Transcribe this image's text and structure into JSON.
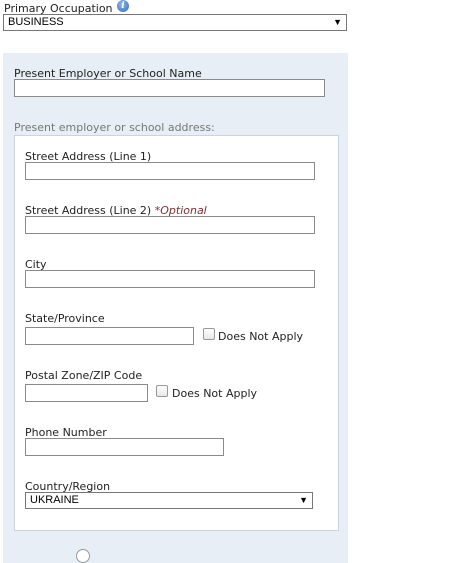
{
  "primary_occupation": {
    "label": "Primary Occupation",
    "value": "BUSINESS"
  },
  "employer": {
    "name_label": "Present Employer or School Name",
    "name_value": "",
    "address_heading": "Present employer or school address:",
    "street1_label": "Street Address (Line 1)",
    "street2_label": "Street Address (Line 2)",
    "street2_optional": "*Optional",
    "city_label": "City",
    "state_label": "State/Province",
    "state_dna": "Does Not Apply",
    "postal_label": "Postal Zone/ZIP Code",
    "postal_dna": "Does Not Apply",
    "phone_label": "Phone Number",
    "country_label": "Country/Region",
    "country_value": "UKRAINE"
  },
  "icons": {
    "info": "info-icon",
    "dropdown": "chevron-down-icon"
  },
  "colors": {
    "panel_bg": "#e7eef6",
    "optional_text": "#7a2e2e",
    "heading_gray": "#777777"
  }
}
